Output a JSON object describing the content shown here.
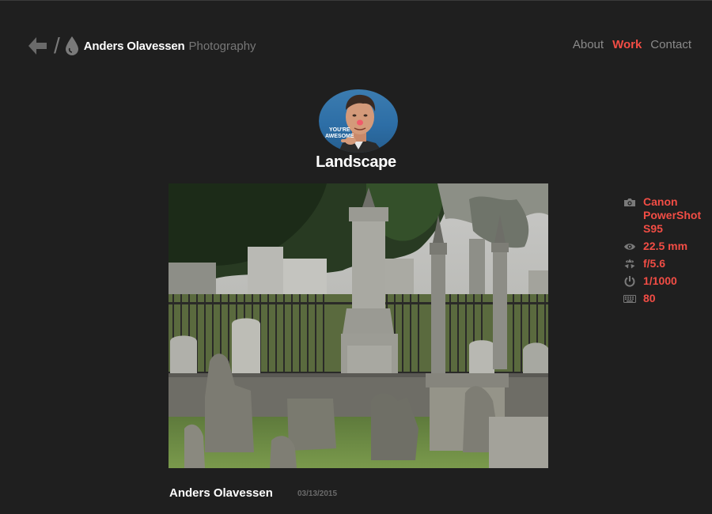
{
  "header": {
    "back_icon": "back-arrow-icon",
    "separator": "/",
    "logo_icon": "droplet-icon",
    "brand_name": "Anders Olavessen",
    "brand_sub": "Photography"
  },
  "nav": {
    "items": [
      {
        "label": "About",
        "active": false
      },
      {
        "label": "Work",
        "active": true
      },
      {
        "label": "Contact",
        "active": false
      }
    ]
  },
  "avatar": {
    "caption_line1": "YOU'RE",
    "caption_line2": "AWESOME"
  },
  "category": "Landscape",
  "exif": {
    "camera": {
      "icon": "camera-icon",
      "value": "Canon PowerShot S95"
    },
    "focal": {
      "icon": "eye-icon",
      "value": "22.5 mm"
    },
    "aperture": {
      "icon": "aperture-icon",
      "value": "f/5.6"
    },
    "shutter": {
      "icon": "power-icon",
      "value": "1/1000"
    },
    "iso": {
      "icon": "keyboard-icon",
      "value": "80"
    }
  },
  "footer": {
    "author": "Anders Olavessen",
    "date": "03/13/2015"
  },
  "colors": {
    "background": "#1f1f1f",
    "accent": "#f24d45",
    "muted": "#8a8a8a"
  }
}
